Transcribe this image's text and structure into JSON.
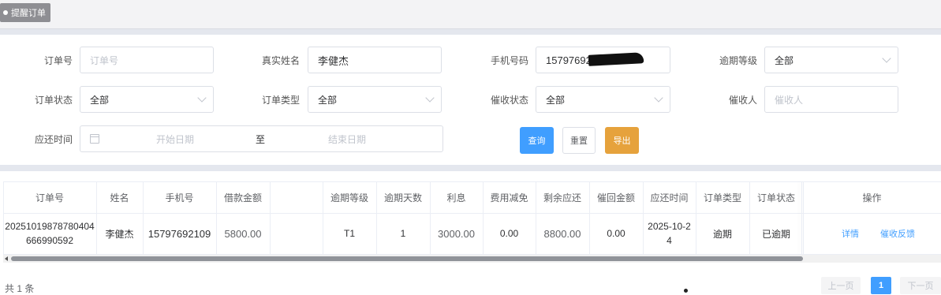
{
  "tab": {
    "label": "提醒订单"
  },
  "form": {
    "order_no": {
      "label": "订单号",
      "placeholder": "订单号"
    },
    "real_name": {
      "label": "真实姓名",
      "value": "李健杰"
    },
    "phone": {
      "label": "手机号码",
      "value": "15797692109"
    },
    "overdue_level": {
      "label": "逾期等级",
      "value": "全部"
    },
    "order_status": {
      "label": "订单状态",
      "value": "全部"
    },
    "order_type": {
      "label": "订单类型",
      "value": "全部"
    },
    "collection_status": {
      "label": "催收状态",
      "value": "全部"
    },
    "collector": {
      "label": "催收人",
      "placeholder": "催收人"
    },
    "due_time": {
      "label": "应还时间",
      "start_placeholder": "开始日期",
      "separator": "至",
      "end_placeholder": "结束日期"
    },
    "buttons": {
      "query": "查询",
      "reset": "重置",
      "export": "导出"
    }
  },
  "table": {
    "headers": [
      "订单号",
      "姓名",
      "手机号",
      "借款金额",
      "",
      "逾期等级",
      "逾期天数",
      "利息",
      "费用减免",
      "剩余应还",
      "催回金额",
      "应还时间",
      "订单类型",
      "订单状态",
      "操作"
    ],
    "rows": [
      {
        "order_no": "20251019878780404666990592",
        "name": "李健杰",
        "phone": "15797692109",
        "loan_amount": "5800.00",
        "blank": "",
        "overdue_level": "T1",
        "overdue_days": "1",
        "interest": "3000.00",
        "fee_waiver": "0.00",
        "remaining": "8800.00",
        "recovered": "0.00",
        "due_time": "2025-10-24",
        "order_type": "逾期",
        "order_status": "已逾期",
        "actions": [
          "详情",
          "催收反馈"
        ]
      }
    ]
  },
  "footer": {
    "total": "共 1 条",
    "prev": "上一页",
    "page": "1",
    "next": "下一页"
  }
}
